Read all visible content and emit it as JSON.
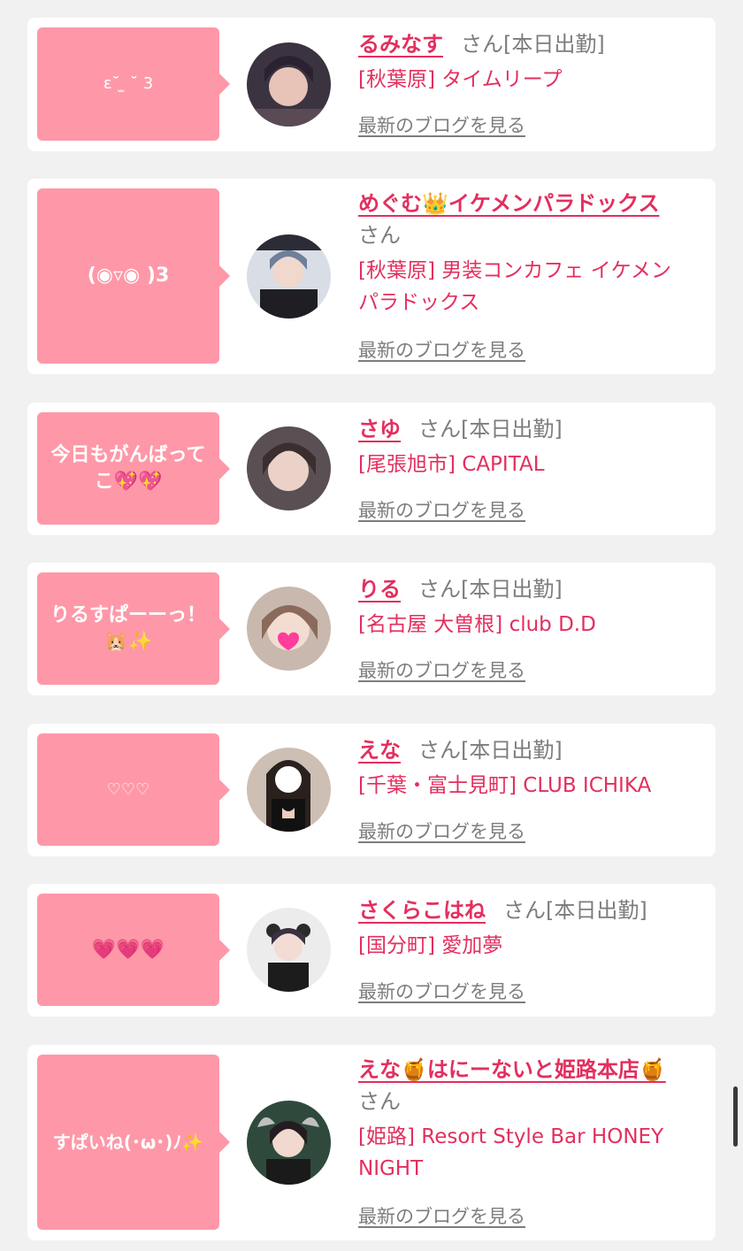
{
  "cards": [
    {
      "message": "ε˘̆ ̫ ˘̆ 3",
      "name": "るみなす",
      "san": "さん",
      "status": "[本日出勤]",
      "shop": "[秋葉原] タイムリープ",
      "blog_link": "最新のブログを見る"
    },
    {
      "message": "(◉▿◉ )3",
      "name": "めぐむ👑イケメンパラドックス",
      "san": "さん",
      "status": "",
      "shop": "[秋葉原] 男装コンカフェ イケメンパラドックス",
      "blog_link": "最新のブログを見る"
    },
    {
      "message": "今日もがんばってこ💖💖",
      "name": "さゆ",
      "san": "さん",
      "status": "[本日出勤]",
      "shop": "[尾張旭市] CAPITAL",
      "blog_link": "最新のブログを見る"
    },
    {
      "message": "りるすぱーーっ！🐹✨",
      "name": "りる",
      "san": "さん",
      "status": "[本日出勤]",
      "shop": "[名古屋 大曽根] club D.D",
      "blog_link": "最新のブログを見る"
    },
    {
      "message": "♡♡♡",
      "name": "えな",
      "san": "さん",
      "status": "[本日出勤]",
      "shop": "[千葉・富士見町] CLUB ICHIKA",
      "blog_link": "最新のブログを見る"
    },
    {
      "message": "💗💗💗",
      "name": "さくらこはね",
      "san": "さん",
      "status": "[本日出勤]",
      "shop": "[国分町] 愛加夢",
      "blog_link": "最新のブログを見る"
    },
    {
      "message": "すぱいね(･ω･)ﾉ✨",
      "name": "えな🍯はにーないと姫路本店🍯",
      "san": "さん",
      "status": "",
      "shop": "[姫路] Resort Style Bar HONEY NIGHT",
      "blog_link": "最新のブログを見る"
    }
  ],
  "colors": {
    "page_bg": "#f1f1f1",
    "card_bg": "#ffffff",
    "bubble_bg": "#fe98a8",
    "name_color": "#e32f5e",
    "muted_text": "#7d7d7d"
  }
}
